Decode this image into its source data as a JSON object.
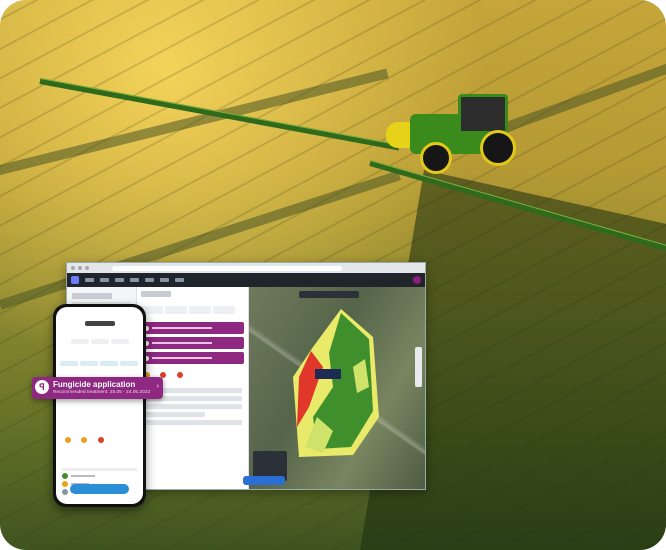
{
  "scene": {
    "alt": "Tractor spraying a field with app screens overlaid"
  },
  "popup": {
    "title": "Fungicide application",
    "subtitle": "Recommended treatment: 25.05 - 24.05.2023",
    "icon": "spray-icon",
    "chevron": "›"
  },
  "colors": {
    "accent": "#8e2880",
    "primary_button": "#2a6fd6"
  }
}
